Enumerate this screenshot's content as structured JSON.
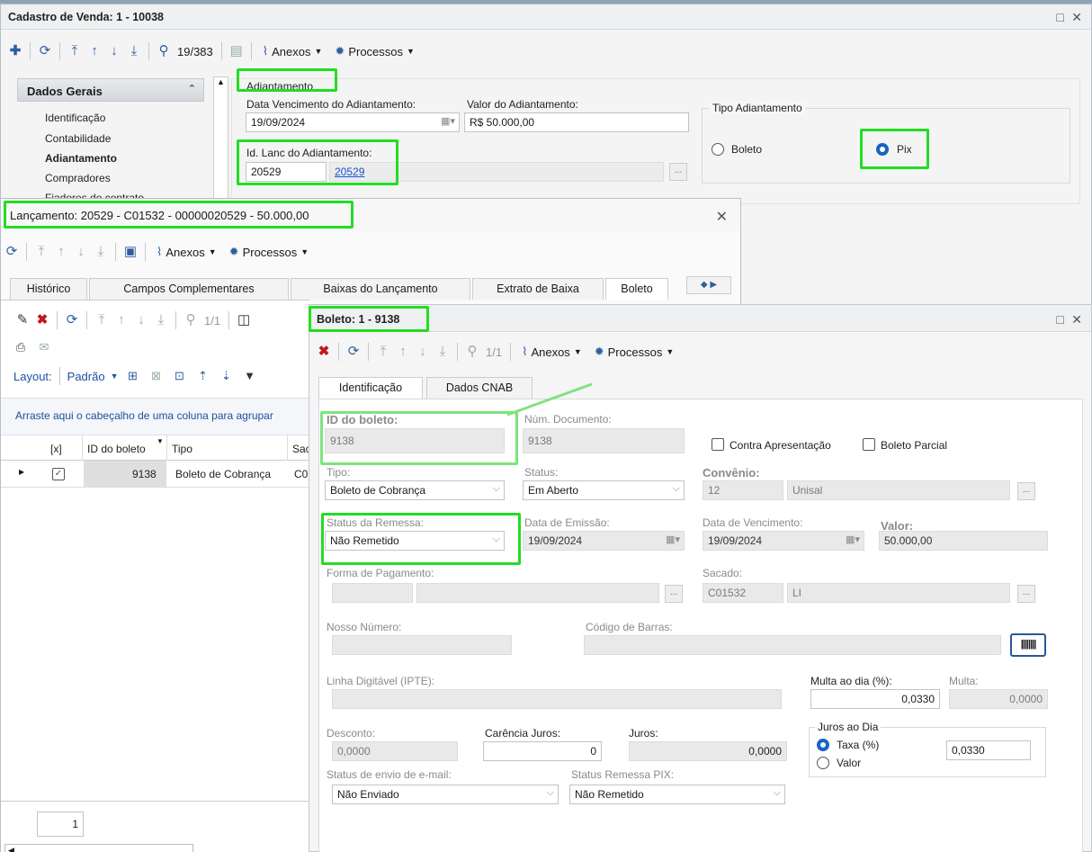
{
  "main_window": {
    "title": "Cadastro de Venda: 1 - 10038",
    "record_counter": "19/383",
    "anexos": "Anexos",
    "processos": "Processos",
    "nav": {
      "header": "Dados Gerais",
      "items": [
        "Identificação",
        "Contabilidade",
        "Adiantamento",
        "Compradores",
        "Fiadores do contrato"
      ]
    },
    "section_title": "Adiantamento",
    "data_vencimento_label": "Data Vencimento do Adiantamento:",
    "data_vencimento_value": "19/09/2024",
    "valor_label": "Valor do Adiantamento:",
    "valor_value": "R$ 50.000,00",
    "tipo_label": "Tipo Adiantamento",
    "boleto_label": "Boleto",
    "pix_label": "Pix",
    "id_lanc_label": "Id. Lanc do Adiantamento:",
    "id_lanc_value": "20529",
    "id_lanc_link": "20529"
  },
  "lanc_window": {
    "title": "Lançamento: 20529 - C01532 - 00000020529 - 50.000,00",
    "anexos": "Anexos",
    "processos": "Processos",
    "tabs": [
      "Histórico",
      "Campos Complementares",
      "Baixas do Lançamento",
      "Extrato de Baixa",
      "Boleto"
    ],
    "counter": "1/1",
    "layout_label": "Layout:",
    "layout_value": "Padrão",
    "group_hint": "Arraste aqui o cabeçalho de uma coluna para agrupar",
    "grid_headers": [
      "[x]",
      "ID do boleto",
      "Tipo",
      "Sac"
    ],
    "grid_row": {
      "id": "9138",
      "tipo": "Boleto de Cobrança",
      "sac": "C0"
    },
    "page_number": "1"
  },
  "boleto_window": {
    "title": "Boleto: 1 - 9138",
    "counter": "1/1",
    "anexos": "Anexos",
    "processos": "Processos",
    "tabs": [
      "Identificação",
      "Dados CNAB"
    ],
    "id_label": "ID do boleto:",
    "id_value": "9138",
    "num_doc_label": "Núm. Documento:",
    "num_doc_value": "9138",
    "contra_label": "Contra Apresentação",
    "parcial_label": "Boleto Parcial",
    "tipo_label": "Tipo:",
    "tipo_value": "Boleto de Cobrança",
    "status_label": "Status:",
    "status_value": "Em Aberto",
    "convenio_label": "Convênio:",
    "convenio_code": "12",
    "convenio_name": "Unisal",
    "status_remessa_label": "Status da Remessa:",
    "status_remessa_value": "Não Remetido",
    "data_emissao_label": "Data de Emissão:",
    "data_emissao_value": "19/09/2024",
    "data_venc_label": "Data de Vencimento:",
    "data_venc_value": "19/09/2024",
    "valor_label": "Valor:",
    "valor_value": "50.000,00",
    "forma_pag_label": "Forma de Pagamento:",
    "sacado_label": "Sacado:",
    "sacado_code": "C01532",
    "sacado_name": "LI",
    "nosso_num_label": "Nosso Número:",
    "cod_barras_label": "Código de Barras:",
    "linha_label": "Linha Digitável (IPTE):",
    "multa_dia_label": "Multa ao dia (%):",
    "multa_dia_value": "0,0330",
    "multa_label": "Multa:",
    "multa_value": "0,0000",
    "desconto_label": "Desconto:",
    "desconto_value": "0,0000",
    "carencia_label": "Carência Juros:",
    "carencia_value": "0",
    "juros_label": "Juros:",
    "juros_value": "0,0000",
    "juros_dia_label": "Juros ao Dia",
    "taxa_label": "Taxa (%)",
    "valor_radio_label": "Valor",
    "juros_dia_value": "0,0330",
    "email_status_label": "Status de envio de e-mail:",
    "email_status_value": "Não Enviado",
    "pix_status_label": "Status Remessa PIX:",
    "pix_status_value": "Não Remetido"
  }
}
